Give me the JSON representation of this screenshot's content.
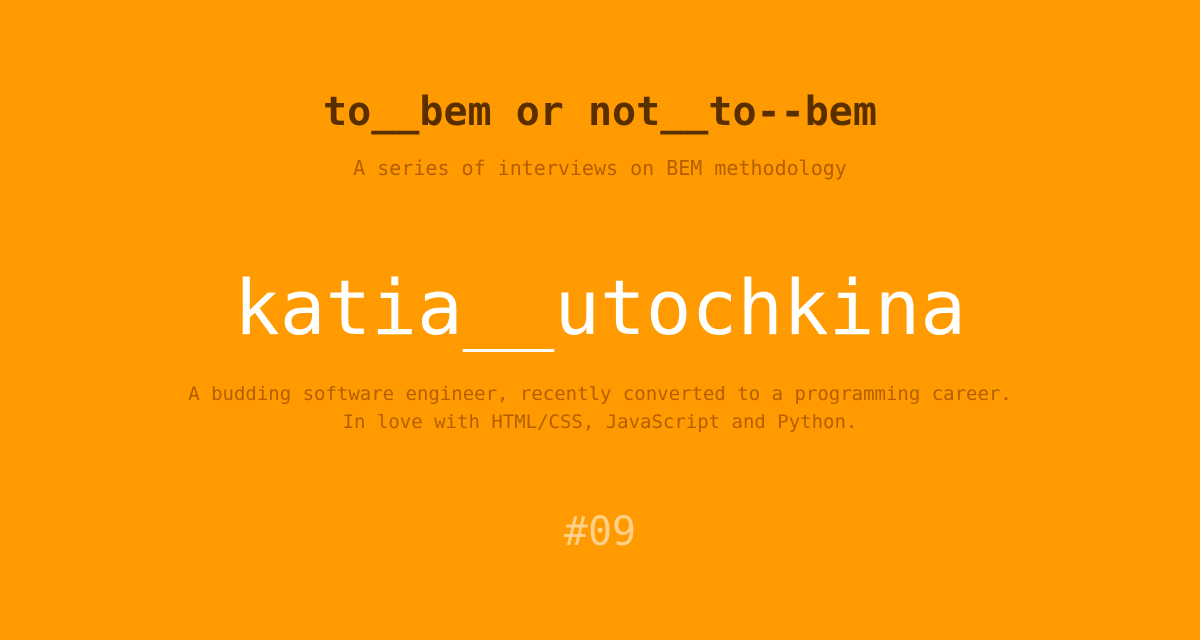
{
  "header": {
    "title": "to__bem or not__to--bem",
    "subtitle": "A series of interviews on BEM methodology"
  },
  "interviewee": {
    "name": "katia__utochkina",
    "bio_lines": [
      "A budding software engineer, recently converted to a programming career.",
      "In love with HTML/CSS, JavaScript and Python."
    ]
  },
  "issue": {
    "number": "#09"
  },
  "colors": {
    "background": "#ff9a00",
    "title": "#5a2f00",
    "muted_text": "#b35f00",
    "name": "#ffffff",
    "issue": "#ffd08a"
  }
}
